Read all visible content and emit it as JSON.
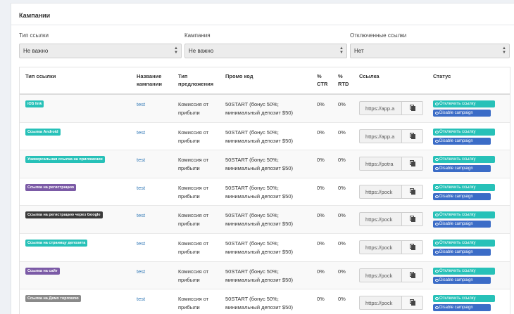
{
  "panel": {
    "title": "Кампании"
  },
  "filters": [
    {
      "label": "Тип ссылки",
      "value": "Не важно"
    },
    {
      "label": "Кампания",
      "value": "Не важно"
    },
    {
      "label": "Отключенные ссылки",
      "value": "Нет"
    }
  ],
  "table": {
    "headers": {
      "type": "Тип ссылки",
      "campaign": "Название кампании",
      "offer": "Тип предложения",
      "promo": "Промо код",
      "ctr": "% CTR",
      "rtd": "% RTD",
      "link": "Ссылка",
      "status": "Статус"
    },
    "status_buttons": {
      "disable_link": "Отключить ссылку",
      "disable_campaign": "Disable campaign"
    },
    "rows": [
      {
        "type": "iOS link",
        "badge_color": "#27c1b8",
        "campaign": "test",
        "offer": "Комиссия от прибыли",
        "promo": "50START (бонус 50%; минимальный депозит $50)",
        "ctr": "0%",
        "rtd": "0%",
        "link": "https://app.a"
      },
      {
        "type": "Ссылка Android",
        "badge_color": "#27c1b8",
        "campaign": "test",
        "offer": "Комиссия от прибыли",
        "promo": "50START (бонус 50%; минимальный депозит $50)",
        "ctr": "0%",
        "rtd": "0%",
        "link": "https://app.a"
      },
      {
        "type": "Универсальная ссылка на приложение",
        "badge_color": "#27c1b8",
        "campaign": "test",
        "offer": "Комиссия от прибыли",
        "promo": "50START (бонус 50%; минимальный депозит $50)",
        "ctr": "0%",
        "rtd": "0%",
        "link": "https://potra"
      },
      {
        "type": "Ссылка на регистрацию",
        "badge_color": "#7b5aa6",
        "campaign": "test",
        "offer": "Комиссия от прибыли",
        "promo": "50START (бонус 50%; минимальный депозит $50)",
        "ctr": "0%",
        "rtd": "0%",
        "link": "https://pock"
      },
      {
        "type": "Ссылка на регистрацию через Google",
        "badge_color": "#3a3a3a",
        "campaign": "test",
        "offer": "Комиссия от прибыли",
        "promo": "50START (бонус 50%; минимальный депозит $50)",
        "ctr": "0%",
        "rtd": "0%",
        "link": "https://pock"
      },
      {
        "type": "Ссылка на страницу депозита",
        "badge_color": "#27c1b8",
        "campaign": "test",
        "offer": "Комиссия от прибыли",
        "promo": "50START (бонус 50%; минимальный депозит $50)",
        "ctr": "0%",
        "rtd": "0%",
        "link": "https://pock"
      },
      {
        "type": "Ссылка на сайт",
        "badge_color": "#7b5aa6",
        "campaign": "test",
        "offer": "Комиссия от прибыли",
        "promo": "50START (бонус 50%; минимальный депозит $50)",
        "ctr": "0%",
        "rtd": "0%",
        "link": "https://pock"
      },
      {
        "type": "Ссылка на Демо торговлю",
        "badge_color": "#8a8a8a",
        "campaign": "test",
        "offer": "Комиссия от прибыли",
        "promo": "50START (бонус 50%; минимальный депозит $50)",
        "ctr": "0%",
        "rtd": "0%",
        "link": "https://pock"
      }
    ]
  }
}
